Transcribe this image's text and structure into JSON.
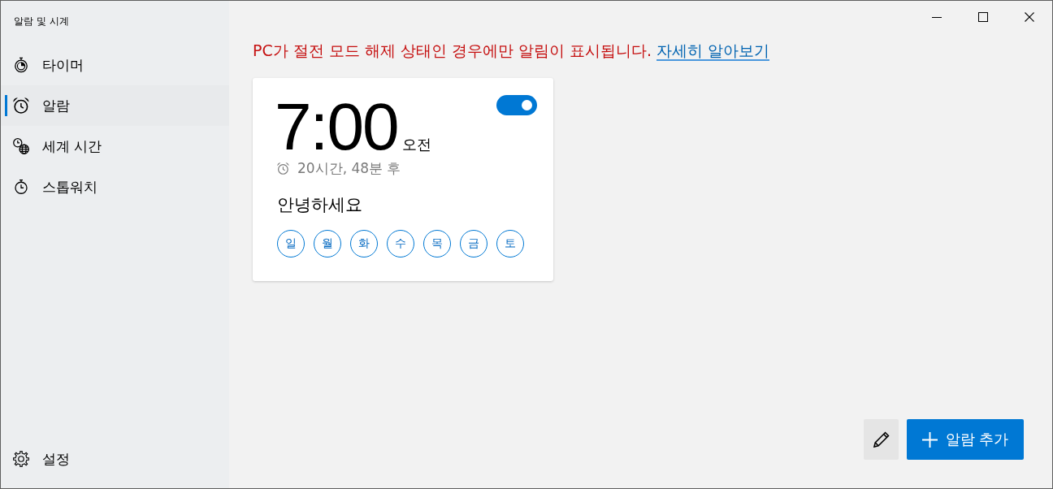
{
  "app": {
    "title": "알람 및 시계"
  },
  "nav": {
    "items": [
      {
        "kind": "timer",
        "label": "타이머",
        "selected": false
      },
      {
        "kind": "alarm",
        "label": "알람",
        "selected": true
      },
      {
        "kind": "world-clock",
        "label": "세계 시간",
        "selected": false
      },
      {
        "kind": "stopwatch",
        "label": "스톱워치",
        "selected": false
      }
    ],
    "settings": {
      "label": "설정"
    }
  },
  "notice": {
    "text": "PC가 절전 모드 해제 상태인 경우에만 알림이 표시됩니다.",
    "link": "자세히 알아보기"
  },
  "alarms": [
    {
      "time": "7:00",
      "period": "오전",
      "remaining": "20시간, 48분 후",
      "name": "안녕하세요",
      "on": true,
      "days": [
        {
          "label": "일",
          "selected": false
        },
        {
          "label": "월",
          "selected": false
        },
        {
          "label": "화",
          "selected": false
        },
        {
          "label": "수",
          "selected": false
        },
        {
          "label": "목",
          "selected": false
        },
        {
          "label": "금",
          "selected": false
        },
        {
          "label": "토",
          "selected": false
        }
      ]
    }
  ],
  "actions": {
    "add_label": "알람 추가"
  }
}
